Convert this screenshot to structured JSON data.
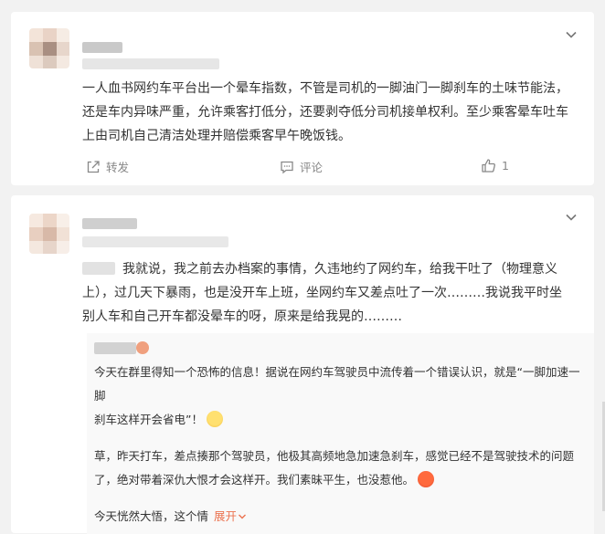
{
  "post1": {
    "text_line1": "一人血书网约车平台出一个晕车指数，不管是司机的一脚油门一脚刹车的土味节能法，",
    "text_line2": "还是车内异味严重，允许乘客打低分，还要剥夺低分司机接单权利。至少乘客晕车吐车",
    "text_line3": "上由司机自己清洁处理并赔偿乘客早午晚饭钱。",
    "repost_label": "转发",
    "comment_label": "评论",
    "like_count": "1",
    "icons": {
      "repost": "repost-icon",
      "comment": "comment-icon",
      "like": "thumbs-up-icon",
      "menu": "chevron-down-icon"
    }
  },
  "post2": {
    "text_line1": "我就说，我之前去办档案的事情，久违地约了网约车，给我干吐了（物理意义",
    "text_line2": "上），过几天下暴雨，也是没开车上班，坐网约车又差点吐了一次………我说我平时坐",
    "text_line3": "别人车和自己开车都没晕车的呀，原来是给我晃的………",
    "reply": {
      "para1_line1": "今天在群里得知一个恐怖的信息！据说在网约车驾驶员中流传着一个错误认识，就是“一脚加速一脚",
      "para1_line2": "刹车这样开会省电”！",
      "para2_line1": "草，昨天打车，差点揍那个驾驶员，他极其高频地急加速急刹车，感觉已经不是驾驶技术的问题",
      "para2_line2": "了，绝对带着深仇大恨才会这样开。我们素昧平生，也没惹他。",
      "para3": "今天恍然大悟，这个情",
      "expand_label": "展开"
    }
  },
  "colors": {
    "accent": "#eb7350",
    "text": "#333333",
    "muted": "#888888",
    "page_bg": "#f2f2f2"
  }
}
